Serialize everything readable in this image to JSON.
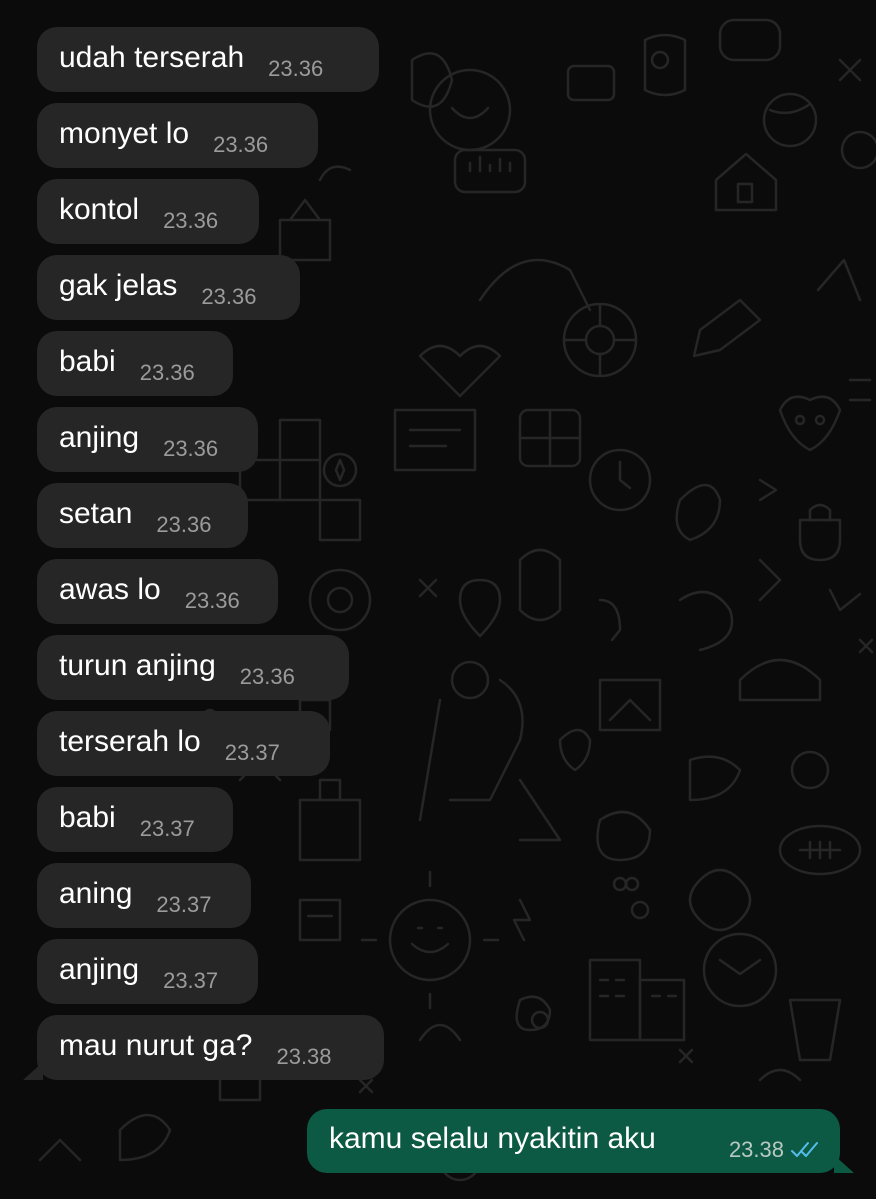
{
  "chat": {
    "incoming": [
      {
        "text": "udah terserah",
        "time": "23.36"
      },
      {
        "text": "monyet lo",
        "time": "23.36"
      },
      {
        "text": "kontol",
        "time": "23.36"
      },
      {
        "text": "gak jelas",
        "time": "23.36"
      },
      {
        "text": "babi",
        "time": "23.36"
      },
      {
        "text": "anjing",
        "time": "23.36"
      },
      {
        "text": "setan",
        "time": "23.36"
      },
      {
        "text": "awas lo",
        "time": "23.36"
      },
      {
        "text": "turun anjing",
        "time": "23.36"
      },
      {
        "text": "terserah lo",
        "time": "23.37"
      },
      {
        "text": "babi",
        "time": "23.37"
      },
      {
        "text": "aning",
        "time": "23.37"
      },
      {
        "text": "anjing",
        "time": "23.37"
      },
      {
        "text": "mau nurut ga?",
        "time": "23.38"
      }
    ],
    "outgoing": {
      "text": "kamu selalu nyakitin aku",
      "time": "23.38",
      "status": "read",
      "status_icon": "double-check-icon",
      "status_color": "#53bdeb"
    }
  },
  "colors": {
    "background": "#0b0b0b",
    "incoming_bubble": "#262626",
    "outgoing_bubble": "#0c5a43",
    "text": "#ffffff",
    "time_incoming": "#9b9b9b"
  }
}
